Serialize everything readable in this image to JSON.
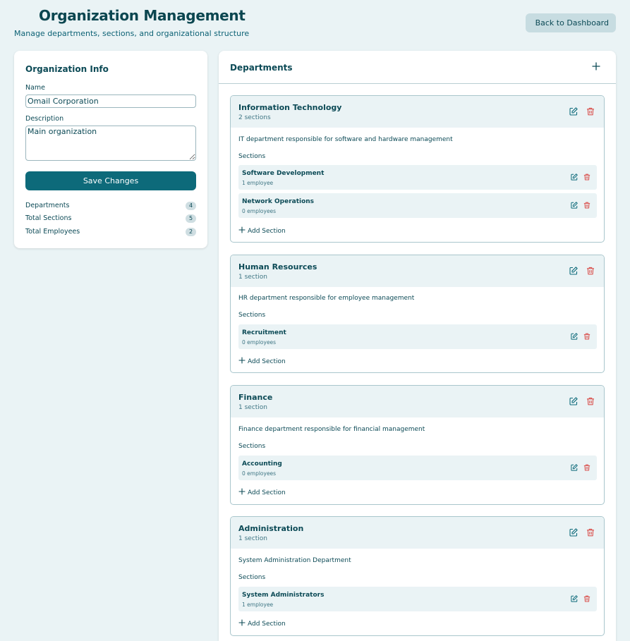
{
  "header": {
    "title": "Organization Management",
    "subtitle": "Manage departments, sections, and organizational structure",
    "back_label": "Back to Dashboard"
  },
  "org_info": {
    "title": "Organization Info",
    "name_label": "Name",
    "name_value": "Omail Corporation",
    "description_label": "Description",
    "description_value": "Main organization",
    "save_label": "Save Changes",
    "stats": [
      {
        "label": "Departments",
        "value": "4"
      },
      {
        "label": "Total Sections",
        "value": "5"
      },
      {
        "label": "Total Employees",
        "value": "2"
      }
    ]
  },
  "departments": {
    "title": "Departments",
    "sections_label": "Sections",
    "add_section_label": "Add Section",
    "items": [
      {
        "name": "Information Technology",
        "count": "2 sections",
        "description": "IT department responsible for software and hardware management",
        "sections": [
          {
            "name": "Software Development",
            "employees": "1 employee"
          },
          {
            "name": "Network Operations",
            "employees": "0 employees"
          }
        ]
      },
      {
        "name": "Human Resources",
        "count": "1 section",
        "description": "HR department responsible for employee management",
        "sections": [
          {
            "name": "Recruitment",
            "employees": "0 employees"
          }
        ]
      },
      {
        "name": "Finance",
        "count": "1 section",
        "description": "Finance department responsible for financial management",
        "sections": [
          {
            "name": "Accounting",
            "employees": "0 employees"
          }
        ]
      },
      {
        "name": "Administration",
        "count": "1 section",
        "description": "System Administration Department",
        "sections": [
          {
            "name": "System Administrators",
            "employees": "1 employee"
          }
        ]
      }
    ]
  },
  "colors": {
    "background": "#eaf3f5",
    "primary": "#0d6a7a",
    "text": "#0c4a56",
    "danger": "#d9534f"
  }
}
